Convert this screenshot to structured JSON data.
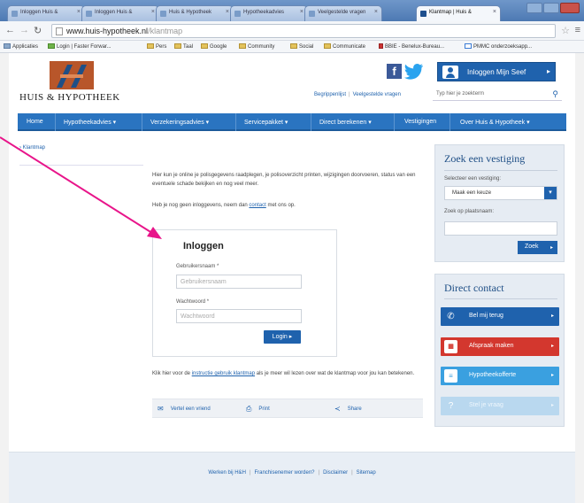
{
  "browser": {
    "tabs": [
      {
        "label": "Inloggen Huis &",
        "active": false
      },
      {
        "label": "Inloggen Huis &",
        "active": false
      },
      {
        "label": "Huis & Hypotheek",
        "active": false
      },
      {
        "label": "Hypotheekadvies",
        "active": false
      },
      {
        "label": "Veelgestelde vragen",
        "active": false
      },
      {
        "label": "Klantmap | Huis &",
        "active": true
      }
    ],
    "url_domain": "www.huis-hypotheek.nl",
    "url_path": "/klantmap",
    "bookmarks": [
      "Applicaties",
      "Login | Faster Forwar...",
      "Pers",
      "Taal",
      "Google",
      "Community",
      "Social",
      "Communicate",
      "BBIE - Benelux-Bureau...",
      "PMMC onderzoeksapp..."
    ]
  },
  "header": {
    "brand": "HUIS & HYPOTHEEK",
    "login_button": "Inloggen Mijn Seef",
    "links": [
      "Begrippenlijst",
      "Veelgestelde vragen"
    ],
    "search_placeholder": "Typ hier je zoekterm"
  },
  "nav": [
    "Home",
    "Hypotheekadvies",
    "Verzekeringsadvies",
    "Servicepakket",
    "Direct berekenen",
    "Vestigingen",
    "Over Huis & Hypotheek"
  ],
  "breadcrumb": "Klantmap",
  "intro_text": "Hier kun je online je polisgegevens raadplegen, je polisoverzicht printen, wijzigingen doorvoeren, status van een eventuele schade bekijken en nog veel meer.",
  "no_login": {
    "before": "Heb je nog geen inloggevens, neem dan ",
    "link": "contact",
    "after": " met ons op."
  },
  "login": {
    "title": "Inloggen",
    "username_label": "Gebruikersnaam *",
    "username_placeholder": "Gebruikersnaam",
    "password_label": "Wachtwoord *",
    "password_placeholder": "Wachtwoord",
    "button": "Login"
  },
  "instructions": {
    "before": "Klik hier voor de ",
    "link": "instructie gebruik klantmap",
    "after": " als je meer wil lezen over wat de klantmap voor jou kan betekenen."
  },
  "share": [
    "Vertel een vriend",
    "Print",
    "Share"
  ],
  "vestiging": {
    "title": "Zoek een vestiging",
    "select_label": "Selecteer een vestiging:",
    "select_value": "Maak een keuze",
    "city_label": "Zoek op plaatsnaam:",
    "search_button": "Zoek"
  },
  "contact": {
    "title": "Direct contact",
    "buttons": [
      "Bel mij terug",
      "Afspraak maken",
      "Hypotheekofferte",
      "Stel je vraag"
    ]
  },
  "footer": [
    "Werken bij H&H",
    "Franchisenemer worden?",
    "Disclaimer",
    "Sitemap"
  ],
  "colors": {
    "primary": "#1f62ad",
    "nav": "#2a74c0",
    "red": "#d3372e",
    "light_blue": "#3aa0e0",
    "annotation_arrow": "#e8158a"
  }
}
